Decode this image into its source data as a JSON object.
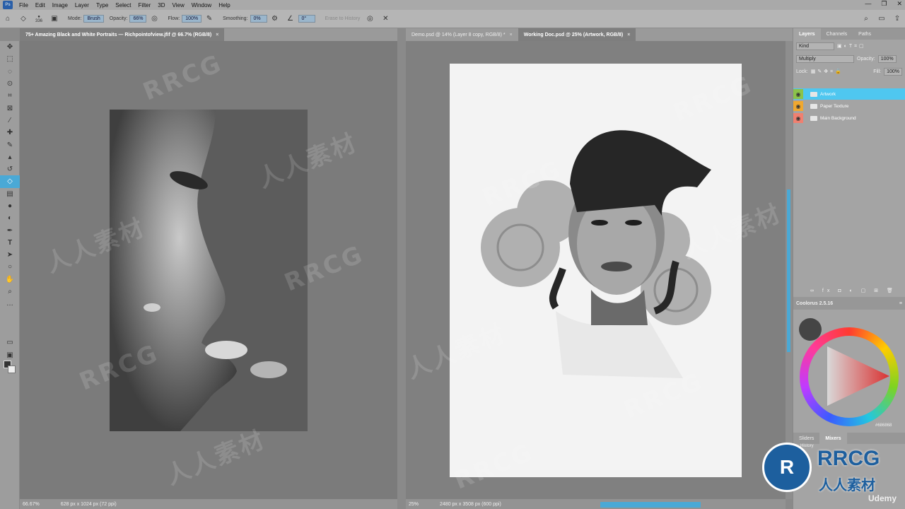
{
  "menubar": {
    "app_icon": "Ps",
    "items": [
      "File",
      "Edit",
      "Image",
      "Layer",
      "Type",
      "Select",
      "Filter",
      "3D",
      "View",
      "Window",
      "Help"
    ]
  },
  "options": {
    "brush_size": "336",
    "mode_label": "Mode:",
    "mode_value": "Brush",
    "opacity_label": "Opacity:",
    "opacity_value": "66%",
    "flow_label": "Flow:",
    "flow_value": "100%",
    "smoothing_label": "Smoothing:",
    "smoothing_value": "0%",
    "angle_value": "0°",
    "erase_history": "Erase to History"
  },
  "tabs_left": [
    {
      "label": "75+ Amazing Black and White Portraits — Richpointofview.jfif @ 66.7% (RGB/8)",
      "close": "×"
    }
  ],
  "tabs_right": [
    {
      "label": "Demo.psd @ 14% (Layer 8 copy, RGB/8) *",
      "close": "×"
    },
    {
      "label": "Working Doc.psd @ 25% (Artwork, RGB/8)",
      "close": "×"
    }
  ],
  "status_left": {
    "zoom": "66.67%",
    "dims": "628 px x 1024 px (72 ppi)"
  },
  "status_right": {
    "zoom": "25%",
    "dims": "2480 px x 3508 px (600 ppi)"
  },
  "layers_panel": {
    "tabs": [
      "Layers",
      "Channels",
      "Paths"
    ],
    "kind": "Kind",
    "blend_mode": "Multiply",
    "opacity_label": "Opacity:",
    "opacity_value": "100%",
    "lock_label": "Lock:",
    "fill_label": "Fill:",
    "fill_value": "100%",
    "layers": [
      {
        "name": "Artwork",
        "color": "#8bc34a"
      },
      {
        "name": "Paper Texture",
        "color": "#f0a830"
      },
      {
        "name": "Main Background",
        "color": "#f08070"
      }
    ]
  },
  "coolorus": {
    "title": "Coolorus 2.5.16",
    "hex": "#686868"
  },
  "bottom_tabs": [
    "Sliders",
    "Mixers"
  ],
  "history_label": "History",
  "udemy": "Udemy",
  "watermark": "RRCG",
  "watermark_cn": "人人素材",
  "logo": {
    "brand": "RRCG",
    "sub": "人人素材"
  },
  "colors": {
    "accent": "#4aa9d6"
  }
}
